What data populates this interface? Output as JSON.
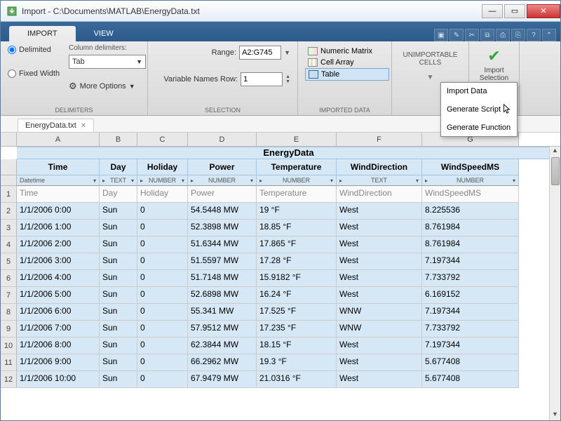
{
  "window": {
    "title": "Import - C:\\Documents\\MATLAB\\EnergyData.txt"
  },
  "tabs": {
    "import": "IMPORT",
    "view": "VIEW"
  },
  "delimiters": {
    "delimited": "Delimited",
    "fixed": "Fixed Width",
    "label": "Column delimiters:",
    "value": "Tab",
    "more": "More Options",
    "group": "DELIMITERS"
  },
  "selection": {
    "range_label": "Range:",
    "range_value": "A2:G745",
    "varrow_label": "Variable Names Row:",
    "varrow_value": "1",
    "group": "SELECTION"
  },
  "output": {
    "numeric": "Numeric Matrix",
    "cell": "Cell Array",
    "table": "Table",
    "group": "IMPORTED DATA"
  },
  "unimportable": {
    "label": "UNIMPORTABLE CELLS"
  },
  "importsel": {
    "label": "Import\nSelection"
  },
  "menu": {
    "import_data": "Import Data",
    "gen_script": "Generate Script",
    "gen_func": "Generate Function"
  },
  "file_tab": "EnergyData.txt",
  "col_letters": [
    "A",
    "B",
    "C",
    "D",
    "E",
    "F",
    "G"
  ],
  "dataset_name": "EnergyData",
  "var_names": [
    "Time",
    "Day",
    "Holiday",
    "Power",
    "Temperature",
    "WindDirection",
    "WindSpeedMS"
  ],
  "var_types": [
    "Datetime",
    "TEXT",
    "NUMBER",
    "NUMBER",
    "NUMBER",
    "TEXT",
    "NUMBER"
  ],
  "rows": [
    {
      "n": 1,
      "hdr": true,
      "cells": [
        "Time",
        "Day",
        "Holiday",
        "Power",
        "Temperature",
        "WindDirection",
        "WindSpeedMS"
      ]
    },
    {
      "n": 2,
      "cells": [
        "1/1/2006 0:00",
        "Sun",
        "0",
        "54.5448 MW",
        "19 °F",
        "West",
        "8.225536"
      ]
    },
    {
      "n": 3,
      "cells": [
        "1/1/2006 1:00",
        "Sun",
        "0",
        "52.3898 MW",
        "18.85 °F",
        "West",
        "8.761984"
      ]
    },
    {
      "n": 4,
      "cells": [
        "1/1/2006 2:00",
        "Sun",
        "0",
        "51.6344 MW",
        "17.865 °F",
        "West",
        "8.761984"
      ]
    },
    {
      "n": 5,
      "cells": [
        "1/1/2006 3:00",
        "Sun",
        "0",
        "51.5597 MW",
        "17.28 °F",
        "West",
        "7.197344"
      ]
    },
    {
      "n": 6,
      "cells": [
        "1/1/2006 4:00",
        "Sun",
        "0",
        "51.7148 MW",
        "15.9182 °F",
        "West",
        "7.733792"
      ]
    },
    {
      "n": 7,
      "cells": [
        "1/1/2006 5:00",
        "Sun",
        "0",
        "52.6898 MW",
        "16.24 °F",
        "West",
        "6.169152"
      ]
    },
    {
      "n": 8,
      "cells": [
        "1/1/2006 6:00",
        "Sun",
        "0",
        "55.341 MW",
        "17.525 °F",
        "WNW",
        "7.197344"
      ]
    },
    {
      "n": 9,
      "cells": [
        "1/1/2006 7:00",
        "Sun",
        "0",
        "57.9512 MW",
        "17.235 °F",
        "WNW",
        "7.733792"
      ]
    },
    {
      "n": 10,
      "cells": [
        "1/1/2006 8:00",
        "Sun",
        "0",
        "62.3844 MW",
        "18.15 °F",
        "West",
        "7.197344"
      ]
    },
    {
      "n": 11,
      "cells": [
        "1/1/2006 9:00",
        "Sun",
        "0",
        "66.2962 MW",
        "19.3 °F",
        "West",
        "5.677408"
      ]
    },
    {
      "n": 12,
      "cells": [
        "1/1/2006 10:00",
        "Sun",
        "0",
        "67.9479 MW",
        "21.0316 °F",
        "West",
        "5.677408"
      ]
    }
  ]
}
